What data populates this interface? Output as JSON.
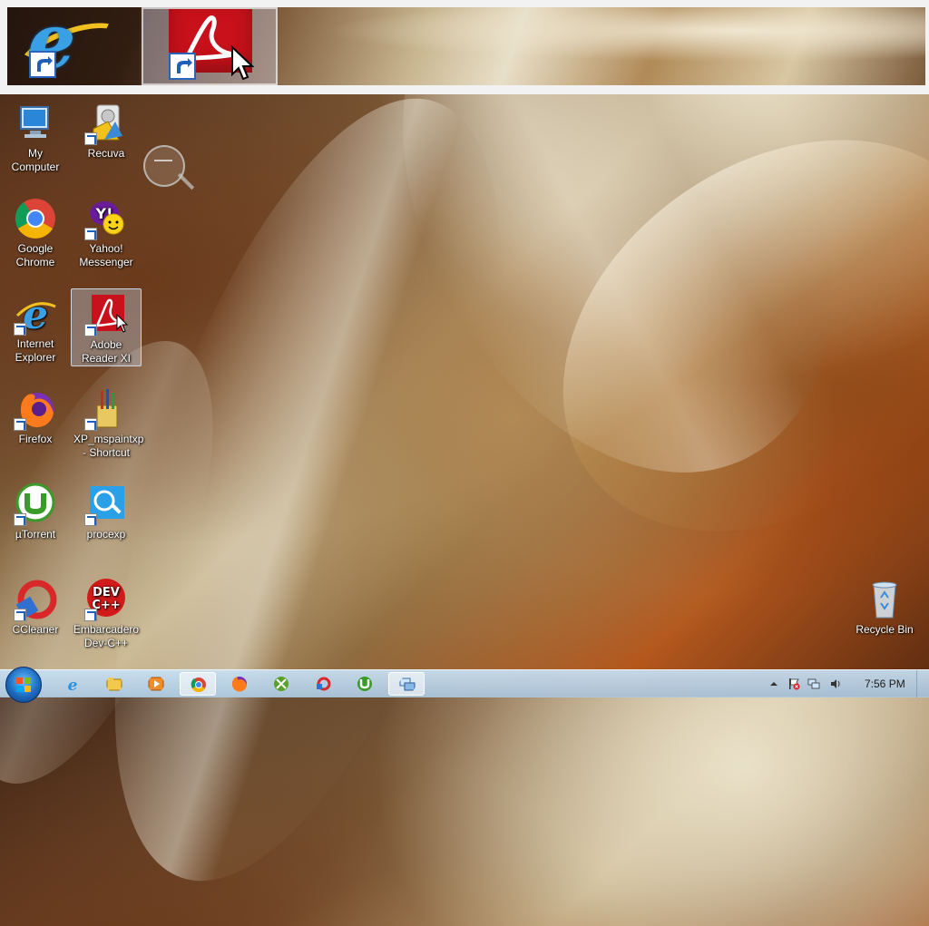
{
  "desktop": {
    "icons": [
      {
        "label": "My Computer",
        "name": "my-computer",
        "selected": false
      },
      {
        "label": "Recuva",
        "name": "recuva",
        "selected": false
      },
      {
        "label": "Google Chrome",
        "name": "google-chrome",
        "selected": false
      },
      {
        "label": "Yahoo! Messenger",
        "name": "yahoo-messenger",
        "selected": false
      },
      {
        "label": "Internet Explorer",
        "name": "internet-explorer",
        "selected": false
      },
      {
        "label": "Adobe Reader XI",
        "name": "adobe-reader-xi",
        "selected": true
      },
      {
        "label": "Firefox",
        "name": "firefox",
        "selected": false
      },
      {
        "label": "XP_mspaintxp - Shortcut",
        "name": "xp-mspaintxp-shortcut",
        "selected": false
      },
      {
        "label": "µTorrent",
        "name": "utorrent",
        "selected": false
      },
      {
        "label": "procexp",
        "name": "procexp",
        "selected": false
      },
      {
        "label": "CCleaner",
        "name": "ccleaner",
        "selected": false
      },
      {
        "label": "Embarcadero Dev-C++",
        "name": "embarcadero-dev-cpp",
        "selected": false
      },
      {
        "label": "Recycle Bin",
        "name": "recycle-bin",
        "selected": false
      }
    ]
  },
  "taskbar": {
    "start_icon": "windows-start-orb",
    "pinned": [
      {
        "name": "internet-explorer",
        "icon": "ie-icon",
        "active": false
      },
      {
        "name": "windows-explorer",
        "icon": "folder-icon",
        "active": false
      },
      {
        "name": "media-player",
        "icon": "media-player-icon",
        "active": false
      },
      {
        "name": "google-chrome",
        "icon": "chrome-icon",
        "active": true
      },
      {
        "name": "firefox",
        "icon": "firefox-icon",
        "active": false
      },
      {
        "name": "xbox-app",
        "icon": "xbox-icon",
        "active": false
      },
      {
        "name": "ccleaner",
        "icon": "ccleaner-icon",
        "active": false
      },
      {
        "name": "utorrent",
        "icon": "utorrent-icon",
        "active": false
      },
      {
        "name": "remote-desktop",
        "icon": "remote-desktop-icon",
        "active": true
      }
    ],
    "tray": {
      "icons": [
        "show-hidden-icons",
        "action-center-flag-icon",
        "network-icon",
        "volume-icon"
      ],
      "clock": "7:56 PM"
    }
  },
  "colors": {
    "adobe_red": "#c8111a",
    "taskbar_top": "#c8e1f5",
    "selection": "#c8dcf5"
  }
}
